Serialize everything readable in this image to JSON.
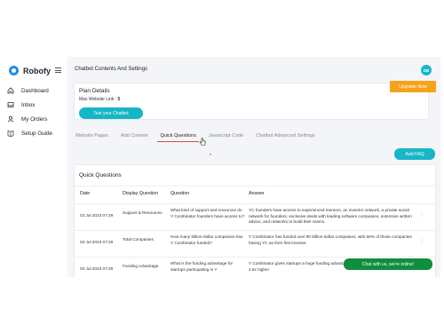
{
  "app": {
    "name": "Robofy"
  },
  "colors": {
    "accent": "#17b6c6",
    "upgrade": "#f6a21a",
    "active_tab_underline": "#e0493d",
    "chat": "#0f8f3e"
  },
  "sidebar": {
    "items": [
      {
        "label": "Dashboard",
        "icon": "home-icon"
      },
      {
        "label": "Inbox",
        "icon": "inbox-icon"
      },
      {
        "label": "My Orders",
        "icon": "user-icon"
      },
      {
        "label": "Setup Guide",
        "icon": "book-icon"
      }
    ]
  },
  "header": {
    "title": "Chatbot Contents And Settings",
    "avatar": "DB"
  },
  "plan": {
    "title": "Plan Details",
    "limit_label": "Max Website Link :",
    "limit_value": "5",
    "test_button": "Test your Chatbot",
    "upgrade_button": "Upgrade Now"
  },
  "tabs": [
    {
      "label": "Website Pages",
      "active": false
    },
    {
      "label": "Add Content",
      "active": false
    },
    {
      "label": "Quick Questions",
      "active": true
    },
    {
      "label": "Javascript Code",
      "active": false
    },
    {
      "label": "Chatbot Advanced Settings",
      "active": false
    }
  ],
  "faq": {
    "add_button": "Add FAQ",
    "title": "Quick Questions",
    "columns": [
      "Date",
      "Display Question",
      "Question",
      "Answer"
    ],
    "rows": [
      {
        "date": "03 Jul 2023 07:29",
        "display": "Support & Resources",
        "question": "What kind of support and resources do Y Combinator founders have access to?",
        "answer": "YC founders have access to experienced mentors, an investor network, a private social network for founders, exclusive deals with leading software companies, extensive written advice, and networks to build their teams."
      },
      {
        "date": "03 Jul 2023 07:29",
        "display": "Total Companies",
        "question": "How many billion-dollar companies has Y Combinator funded?",
        "answer": "Y Combinator has funded over 90 billion-dollar companies, with 65% of those companies having YC as their first investor."
      },
      {
        "date": "03 Jul 2023 07:29",
        "display": "Funding Advantage",
        "question": "What is the funding advantage for startups participating in Y",
        "answer": "Y Combinator gives startups a huge funding advantage. Companies have raised money at 2.5x higher"
      }
    ]
  },
  "chat_widget": {
    "label": "Chat with us, we're online!"
  }
}
